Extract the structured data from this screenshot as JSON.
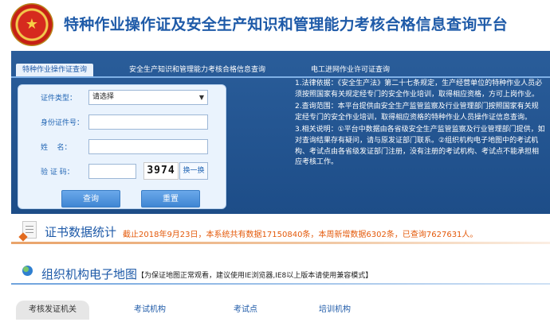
{
  "header": {
    "title": "特种作业操作证及安全生产知识和管理能力考核合格信息查询平台"
  },
  "tabs": [
    {
      "label": "特种作业操作证查询",
      "active": true
    },
    {
      "label": "安全生产知识和管理能力考核合格信息查询",
      "active": false
    },
    {
      "label": "电工进网作业许可证查询",
      "active": false
    }
  ],
  "form": {
    "cert_type_label": "证件类型：",
    "cert_type_value": "请选择",
    "id_label": "身份证件号：",
    "name_label": "姓    名：",
    "captcha_label": "验 证 码：",
    "captcha_value": "3974",
    "refresh_label": "换一换",
    "query_button": "查询",
    "reset_button": "重置"
  },
  "notes": [
    "1.法律依据：《安全生产法》第二十七条规定，生产经营单位的特种作业人员必须按照国家有关规定经专门的安全作业培训，取得相应资格，方可上岗作业。",
    "2.查询范围：本平台提供由安全生产监管监察及行业管理部门按照国家有关规定经专门的安全作业培训，取得相应资格的特种作业人员操作证信息查询。",
    "3.相关说明：①平台中数据由各省级安全生产监管监察及行业管理部门提供，如对查询结果存有疑问，请与原发证部门联系。②组织机构电子地图中的考试机构、考试点由各省级发证部门注册，没有注册的考试机构、考试点不能承担相应考核工作。"
  ],
  "stats": {
    "title": "证书数据统计",
    "text": "截止2018年9月23日，本系统共有数据17150840条，本周新增数据6302条，已查询7627631人。"
  },
  "map": {
    "title": "组织机构电子地图",
    "note": "【为保证地图正常观看，建议使用IE浏览器,IE8以上版本请使用兼容模式】"
  },
  "subtabs": [
    {
      "label": "考核发证机关",
      "active": true
    },
    {
      "label": "考试机构",
      "active": false
    },
    {
      "label": "考试点",
      "active": false
    },
    {
      "label": "培训机构",
      "active": false
    }
  ],
  "colors": {
    "brand_blue": "#1e5aa8",
    "panel_blue": "#1d4d88",
    "stats_orange": "#e45a0b"
  }
}
